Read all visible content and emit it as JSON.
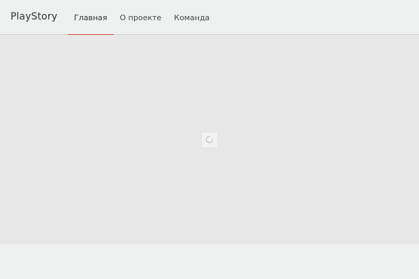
{
  "navbar": {
    "brand": "PlayStory",
    "items": [
      {
        "label": "Главная",
        "active": true
      },
      {
        "label": "О проекте",
        "active": false
      },
      {
        "label": "Команда",
        "active": false
      }
    ]
  },
  "colors": {
    "active_underline": "#d44a3d",
    "navbar_background": "#eef1f0",
    "content_background": "#e7e7e7"
  },
  "main": {
    "loading_icon": "spinner-icon"
  }
}
